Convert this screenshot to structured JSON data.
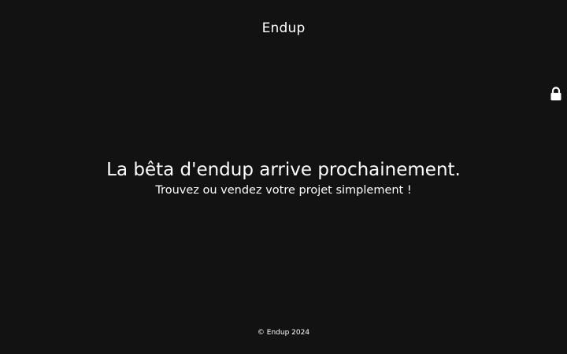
{
  "header": {
    "site_title": "Endup"
  },
  "admin": {
    "lock_icon": "lock-icon"
  },
  "main": {
    "headline": "La bêta d'endup arrive prochainement.",
    "subtitle": "Trouvez ou vendez votre projet simplement !"
  },
  "footer": {
    "copyright": "© Endup 2024"
  },
  "colors": {
    "background": "#121212",
    "text": "#ffffff"
  }
}
